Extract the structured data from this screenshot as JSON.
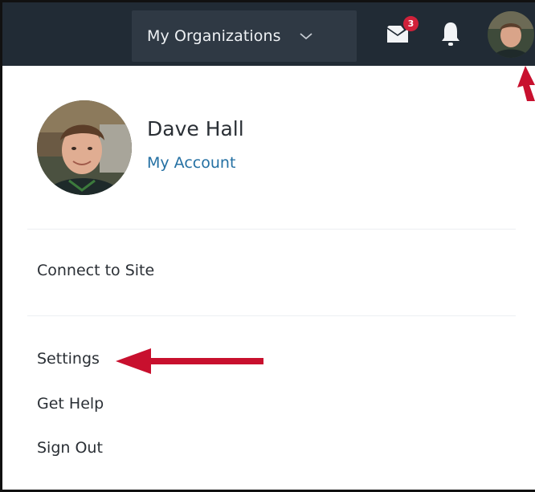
{
  "topbar": {
    "org_dropdown_label": "My Organizations",
    "messages_badge_count": "3",
    "icons": [
      "chevron-down-icon",
      "envelope-icon",
      "bell-icon"
    ]
  },
  "profile": {
    "name": "Dave Hall",
    "account_link": "My Account"
  },
  "menu": {
    "connect": "Connect to Site",
    "settings": "Settings",
    "help": "Get Help",
    "signout": "Sign Out"
  },
  "colors": {
    "topbar_bg": "#212b35",
    "dropdown_bg": "#2f3944",
    "badge": "#d0213a",
    "link": "#2470a3",
    "annotation_arrow": "#c8102e"
  }
}
